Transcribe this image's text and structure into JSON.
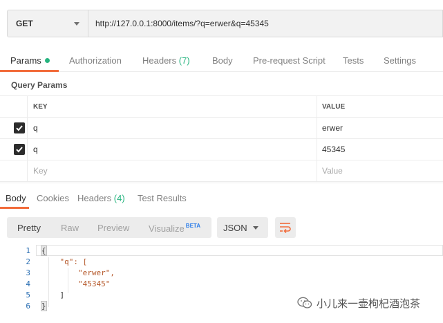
{
  "request": {
    "method": "GET",
    "url": "http://127.0.0.1:8000/items/?q=erwer&q=45345"
  },
  "request_tabs": [
    {
      "label": "Params",
      "active": true
    },
    {
      "label": "Authorization"
    },
    {
      "label": "Headers",
      "count": "(7)"
    },
    {
      "label": "Body"
    },
    {
      "label": "Pre-request Script"
    },
    {
      "label": "Tests"
    },
    {
      "label": "Settings"
    }
  ],
  "query_params": {
    "title": "Query Params",
    "columns": {
      "key": "KEY",
      "value": "VALUE"
    },
    "rows": [
      {
        "checked": true,
        "key": "q",
        "value": "erwer"
      },
      {
        "checked": true,
        "key": "q",
        "value": "45345"
      }
    ],
    "placeholder": {
      "key": "Key",
      "value": "Value"
    }
  },
  "response_tabs": [
    {
      "label": "Body",
      "active": true
    },
    {
      "label": "Cookies"
    },
    {
      "label": "Headers",
      "count": "(4)"
    },
    {
      "label": "Test Results"
    }
  ],
  "format_toolbar": {
    "modes": [
      {
        "label": "Pretty",
        "active": true
      },
      {
        "label": "Raw"
      },
      {
        "label": "Preview"
      },
      {
        "label": "Visualize",
        "badge": "BETA"
      }
    ],
    "language": "JSON",
    "wrap_icon": "wrap-lines-icon"
  },
  "response_body": {
    "line_numbers": [
      "1",
      "2",
      "3",
      "4",
      "5",
      "6"
    ],
    "lines": [
      "{",
      "    \"q\": [",
      "        \"erwer\",",
      "        \"45345\"",
      "    ]",
      "}"
    ]
  },
  "watermark": {
    "text": "小儿来一壶枸杞酒泡茶",
    "icon": "wechat-icon"
  },
  "colors": {
    "accent": "#f26b3a",
    "green": "#26b47f",
    "beta": "#2b7de9"
  }
}
